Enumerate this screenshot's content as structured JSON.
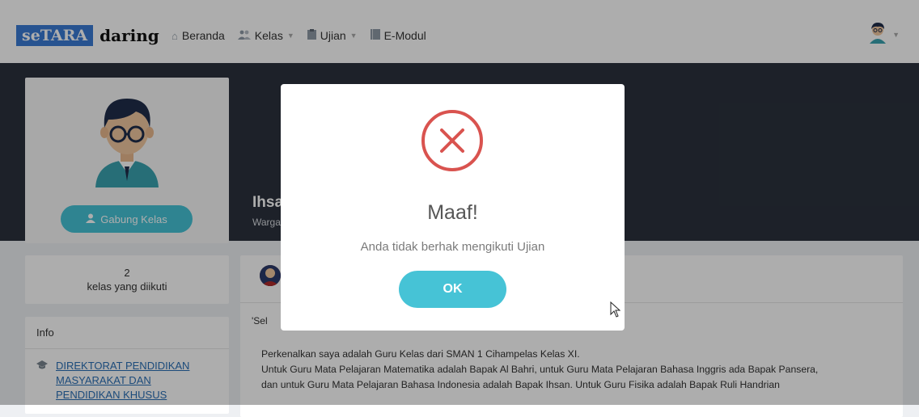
{
  "logo": {
    "se": "seTARA",
    "daring": "daring"
  },
  "nav": {
    "beranda": "Beranda",
    "kelas": "Kelas",
    "ujian": "Ujian",
    "emodul": "E-Modul"
  },
  "profile": {
    "join_label": "Gabung Kelas"
  },
  "hero": {
    "name": "Ihsa",
    "subtitle": "Warga"
  },
  "stats": {
    "count": "2",
    "label": "kelas yang diikuti"
  },
  "info": {
    "heading": "Info",
    "link": "DIREKTORAT PENDIDIKAN MASYARAKAT DAN PENDIDIKAN KHUSUS"
  },
  "post": {
    "quote": "'Sel",
    "line1": "Perkenalkan saya adalah Guru Kelas dari SMAN 1 Cihampelas Kelas XI.",
    "line2": "Untuk Guru Mata Pelajaran Matematika adalah Bapak Al Bahri, untuk Guru Mata Pelajaran Bahasa Inggris ada Bapak Pansera,",
    "line3": "dan untuk Guru Mata Pelajaran Bahasa Indonesia adalah Bapak Ihsan. Untuk Guru Fisika adalah Bapak Ruli Handrian"
  },
  "modal": {
    "title": "Maaf!",
    "message": "Anda tidak berhak mengikuti Ujian",
    "ok_label": "OK",
    "error_color": "#d9534f"
  },
  "colors": {
    "accent": "#46c3d6",
    "hero_bg": "#2b323d",
    "logo_blue": "#3a7bd5"
  }
}
